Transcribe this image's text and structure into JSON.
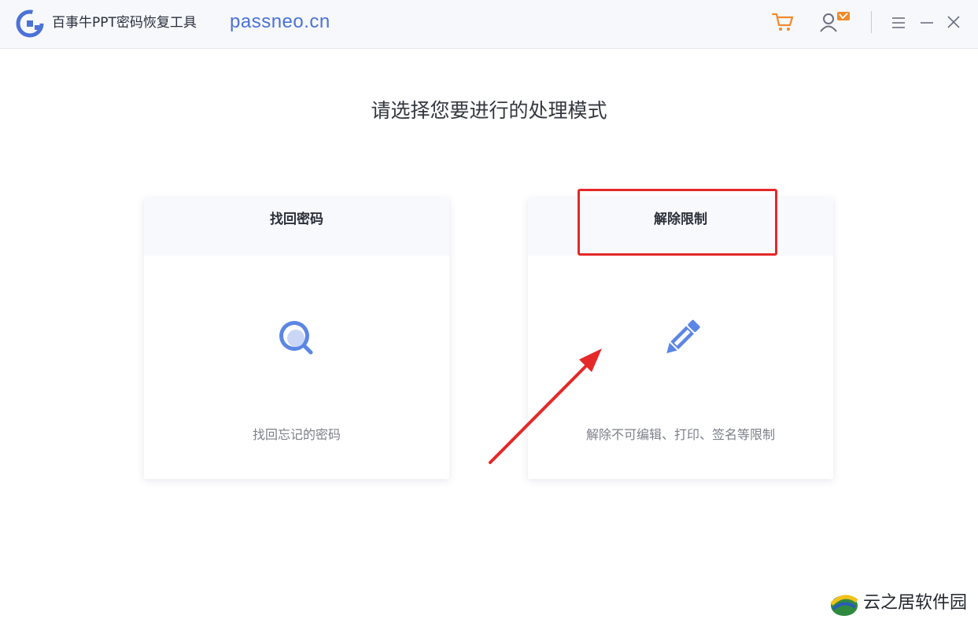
{
  "titlebar": {
    "app_title": "百事牛PPT密码恢复工具",
    "url": "passneo.cn",
    "icons": [
      "app-logo-icon",
      "cart-icon",
      "user-vip-icon",
      "menu-icon",
      "minimize-icon",
      "close-icon"
    ]
  },
  "heading": "请选择您要进行的处理模式",
  "cards": [
    {
      "title": "找回密码",
      "icon": "magnifier-icon",
      "description": "找回忘记的密码"
    },
    {
      "title": "解除限制",
      "icon": "pencil-icon",
      "description": "解除不可编辑、打印、签名等限制"
    }
  ],
  "annotation": {
    "color": "#e52828"
  },
  "watermark": {
    "text": "云之居软件园"
  },
  "colors": {
    "accent": "#4c72d8",
    "icon_blue": "#5b86e5",
    "cart_orange": "#f08a2c"
  }
}
